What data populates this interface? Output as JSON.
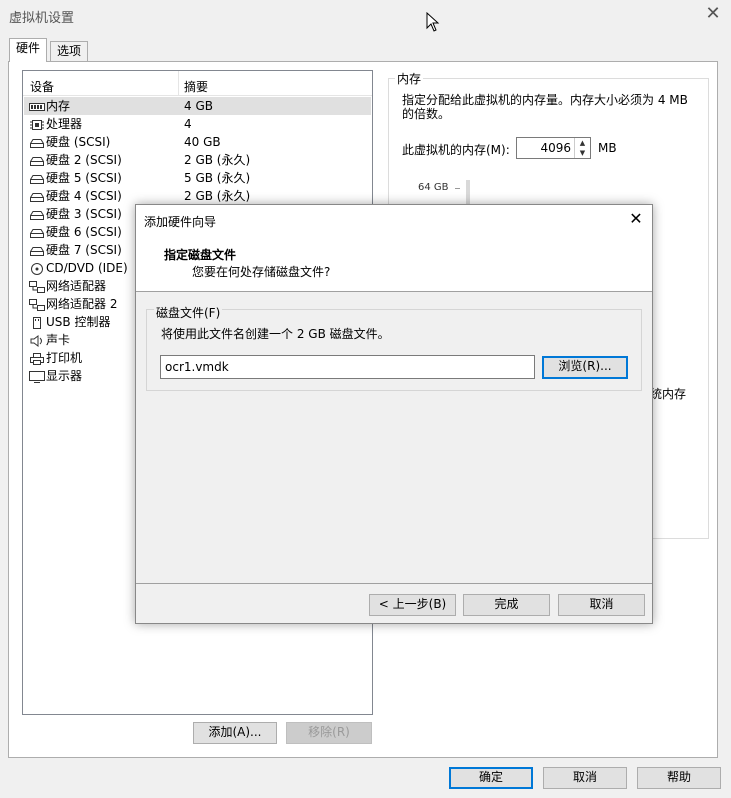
{
  "window": {
    "title": "虚拟机设置",
    "close_label": "✕"
  },
  "tabs": [
    {
      "label": "硬件"
    },
    {
      "label": "选项"
    }
  ],
  "devices": {
    "col_device": "设备",
    "col_summary": "摘要",
    "items": [
      {
        "name": "内存",
        "summary": "4 GB",
        "icon": "memory-icon"
      },
      {
        "name": "处理器",
        "summary": "4",
        "icon": "processor-icon"
      },
      {
        "name": "硬盘 (SCSI)",
        "summary": "40 GB",
        "icon": "hard-disk-icon"
      },
      {
        "name": "硬盘 2 (SCSI)",
        "summary": "2 GB (永久)",
        "icon": "hard-disk-icon"
      },
      {
        "name": "硬盘 5 (SCSI)",
        "summary": "5 GB (永久)",
        "icon": "hard-disk-icon"
      },
      {
        "name": "硬盘 4 (SCSI)",
        "summary": "2 GB (永久)",
        "icon": "hard-disk-icon"
      },
      {
        "name": "硬盘 3 (SCSI)",
        "summary": "",
        "icon": "hard-disk-icon"
      },
      {
        "name": "硬盘 6 (SCSI)",
        "summary": "",
        "icon": "hard-disk-icon"
      },
      {
        "name": "硬盘 7 (SCSI)",
        "summary": "",
        "icon": "hard-disk-icon"
      },
      {
        "name": "CD/DVD (IDE)",
        "summary": "",
        "icon": "cd-dvd-icon"
      },
      {
        "name": "网络适配器",
        "summary": "",
        "icon": "network-adapter-icon"
      },
      {
        "name": "网络适配器 2",
        "summary": "",
        "icon": "network-adapter-icon"
      },
      {
        "name": "USB 控制器",
        "summary": "",
        "icon": "usb-icon"
      },
      {
        "name": "声卡",
        "summary": "",
        "icon": "sound-card-icon"
      },
      {
        "name": "打印机",
        "summary": "",
        "icon": "printer-icon"
      },
      {
        "name": "显示器",
        "summary": "",
        "icon": "display-icon"
      }
    ],
    "add_label": "添加(A)...",
    "remove_label": "移除(R)"
  },
  "memory": {
    "legend": "内存",
    "description": "指定分配给此虚拟机的内存量。内存大小必须为 4 MB 的倍数。",
    "field_label": "此虚拟机的内存(M):",
    "value": "4096",
    "unit": "MB",
    "scale_top": "64 GB",
    "system_memory_partial": "系统内存"
  },
  "wizard": {
    "title": "添加硬件向导",
    "heading": "指定磁盘文件",
    "subheading": "您要在何处存储磁盘文件?",
    "group_label": "磁盘文件(F)",
    "info": "将使用此文件名创建一个 2 GB 磁盘文件。",
    "filename": "ocr1.vmdk",
    "browse_label": "浏览(R)...",
    "back_label": "< 上一步(B)",
    "finish_label": "完成",
    "cancel_label": "取消",
    "close_label": "✕"
  },
  "footer": {
    "ok_label": "确定",
    "cancel_label": "取消",
    "help_label": "帮助"
  }
}
